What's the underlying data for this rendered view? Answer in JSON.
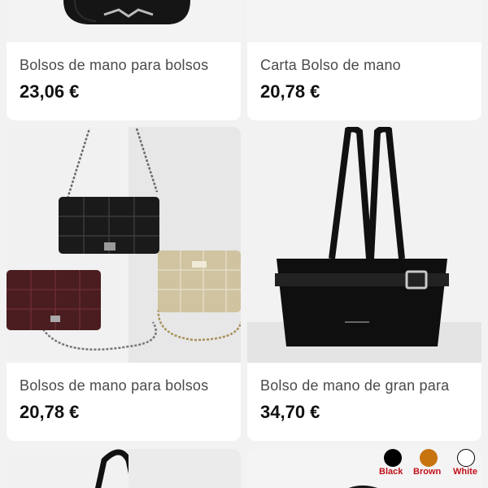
{
  "products": [
    {
      "title": "Bolsos de mano para bolsos",
      "price": "23,06 €"
    },
    {
      "title": "Carta Bolso de mano",
      "price": "20,78 €"
    },
    {
      "title": "Bolsos de mano para bolsos",
      "price": "20,78 €"
    },
    {
      "title": "Bolso de mano de gran para",
      "price": "34,70 €"
    }
  ],
  "color_options": [
    {
      "label": "Black",
      "color": "#000000"
    },
    {
      "label": "Brown",
      "color": "#c8740e"
    },
    {
      "label": "White",
      "color": "#ffffff"
    }
  ],
  "colors": {
    "background": "#f2f2f2",
    "card": "#ffffff",
    "price": "#111111",
    "title": "#4a4a4a",
    "swatch_label": "#c0121b"
  }
}
